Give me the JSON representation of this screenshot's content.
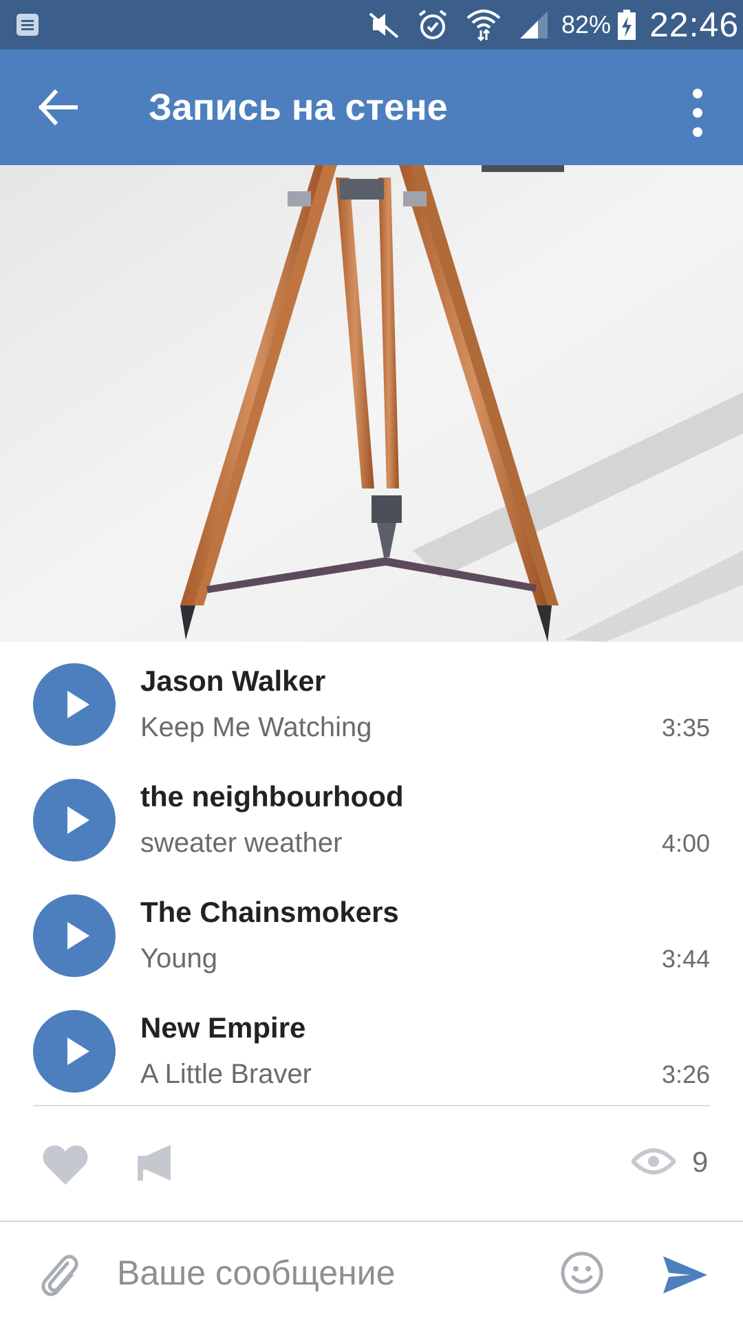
{
  "status_bar": {
    "battery": "82%",
    "time": "22:46",
    "icons": [
      "notification-icon",
      "mute-icon",
      "alarm-icon",
      "wifi-icon",
      "signal-icon",
      "battery-charging-icon"
    ]
  },
  "app_bar": {
    "title": "Запись на стене",
    "back_icon": "arrow-left-icon",
    "menu_icon": "more-vertical-icon"
  },
  "post": {
    "photo": "tripod-photo",
    "tracks": [
      {
        "artist": "Jason Walker",
        "title": "Keep Me Watching",
        "duration": "3:35"
      },
      {
        "artist": "the neighbourhood",
        "title": "sweater weather",
        "duration": "4:00"
      },
      {
        "artist": "The Chainsmokers",
        "title": "Young",
        "duration": "3:44"
      },
      {
        "artist": "New Empire",
        "title": "A Little Braver",
        "duration": "3:26"
      }
    ],
    "views": "9"
  },
  "composer": {
    "placeholder": "Ваше сообщение"
  },
  "colors": {
    "status_bar": "#3b5f8a",
    "app_bar": "#4d7fbe",
    "accent": "#4d7fbe"
  }
}
